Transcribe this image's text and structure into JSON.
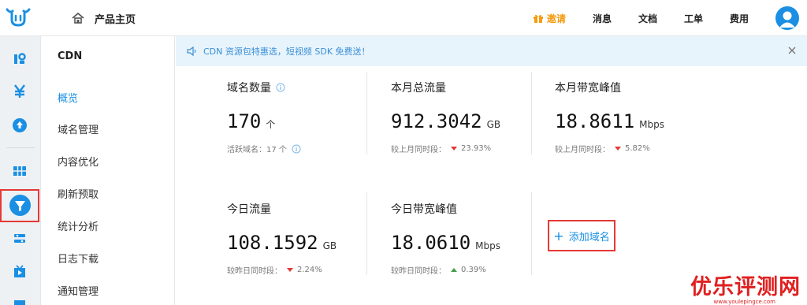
{
  "header": {
    "home_label": "产品主页",
    "nav": [
      {
        "label": "邀请",
        "accent": "#f39c12"
      },
      {
        "label": "消息"
      },
      {
        "label": "文档"
      },
      {
        "label": "工单"
      },
      {
        "label": "费用"
      }
    ]
  },
  "sidebar": {
    "title": "CDN",
    "items": [
      {
        "label": "概览",
        "active": true
      },
      {
        "label": "域名管理"
      },
      {
        "label": "内容优化"
      },
      {
        "label": "刷新预取"
      },
      {
        "label": "统计分析"
      },
      {
        "label": "日志下载"
      },
      {
        "label": "通知管理"
      }
    ]
  },
  "notice": {
    "text": "CDN 资源包特惠选，短视频 SDK 免费送！"
  },
  "stats": [
    {
      "label": "域名数量",
      "value": "170",
      "unit": "个",
      "sub_prefix": "活跃域名：17 个",
      "has_info": true
    },
    {
      "label": "本月总流量",
      "value": "912.3042",
      "unit": "GB",
      "sub_prefix": "较上月同时段：",
      "trend": "down",
      "change": "23.93%"
    },
    {
      "label": "本月带宽峰值",
      "value": "18.8611",
      "unit": "Mbps",
      "sub_prefix": "较上月同时段：",
      "trend": "down",
      "change": "5.82%"
    },
    {
      "label": "今日流量",
      "value": "108.1592",
      "unit": "GB",
      "sub_prefix": "较昨日同时段：",
      "trend": "down",
      "change": "2.24%"
    },
    {
      "label": "今日带宽峰值",
      "value": "18.0610",
      "unit": "Mbps",
      "sub_prefix": "较昨日同时段：",
      "trend": "up",
      "change": "0.39%"
    }
  ],
  "add_domain_label": "添加域名",
  "watermark": {
    "text": "优乐评测网",
    "sub": "www.youlepingce.com"
  },
  "colors": {
    "accent": "#1a8fe3",
    "highlight": "#e53935",
    "trend_down": "#e53935",
    "trend_up": "#43a047"
  }
}
